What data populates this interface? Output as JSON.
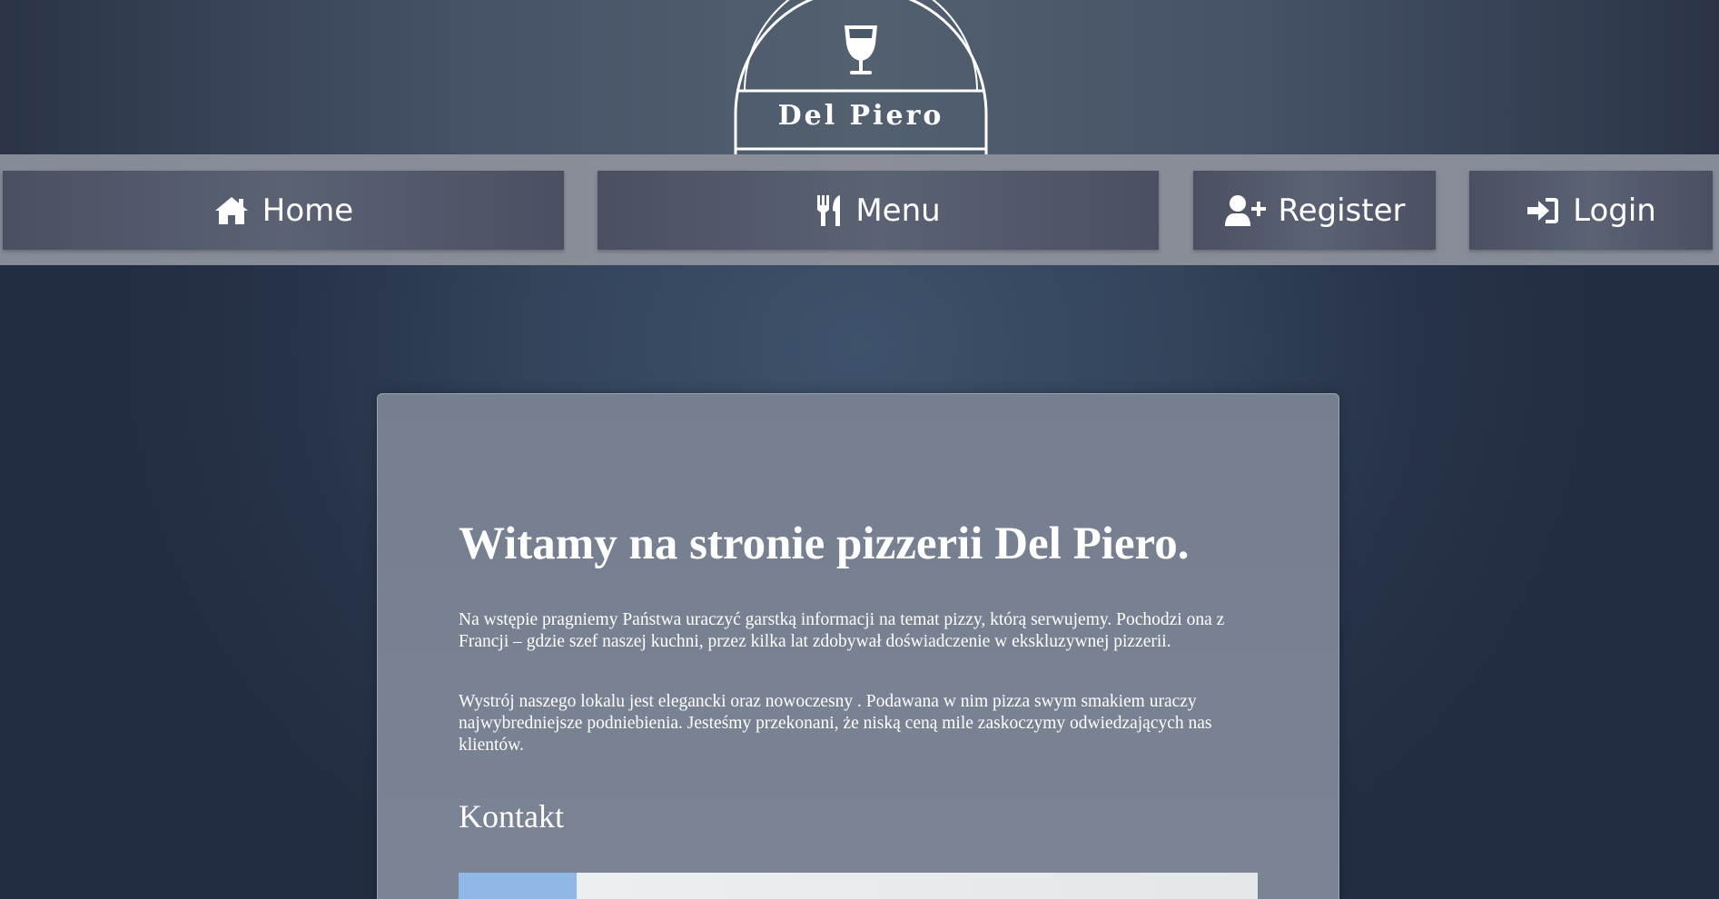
{
  "brand": {
    "name": "Del Piero",
    "logo_icon": "wine-glass-icon"
  },
  "nav": [
    {
      "label": "Home",
      "icon": "home-icon"
    },
    {
      "label": "Menu",
      "icon": "utensils-icon"
    },
    {
      "label": "Register",
      "icon": "user-plus-icon"
    },
    {
      "label": "Login",
      "icon": "sign-in-icon"
    }
  ],
  "content": {
    "title": "Witamy na stronie pizzerii Del Piero.",
    "paragraph1": "Na wstępie pragniemy Państwa uraczyć garstką informacji na temat pizzy, którą serwujemy. Pochodzi ona z Francji – gdzie szef naszej kuchni, przez kilka lat zdobywał doświadczenie w ekskluzywnej pizzerii.",
    "paragraph2": "Wystrój naszego lokalu jest elegancki oraz nowoczesny . Podawana w nim pizza swym smakiem uraczy najwybredniejsze podniebienia. Jesteśmy przekonani, że niską ceną mile zaskoczymy odwiedzających nas klientów.",
    "contact_heading": "Kontakt"
  },
  "colors": {
    "header": "#465368",
    "navbar": "#8a8e99",
    "nav_button": "#535a6c",
    "card": "#767f8f",
    "text": "#ffffff"
  }
}
